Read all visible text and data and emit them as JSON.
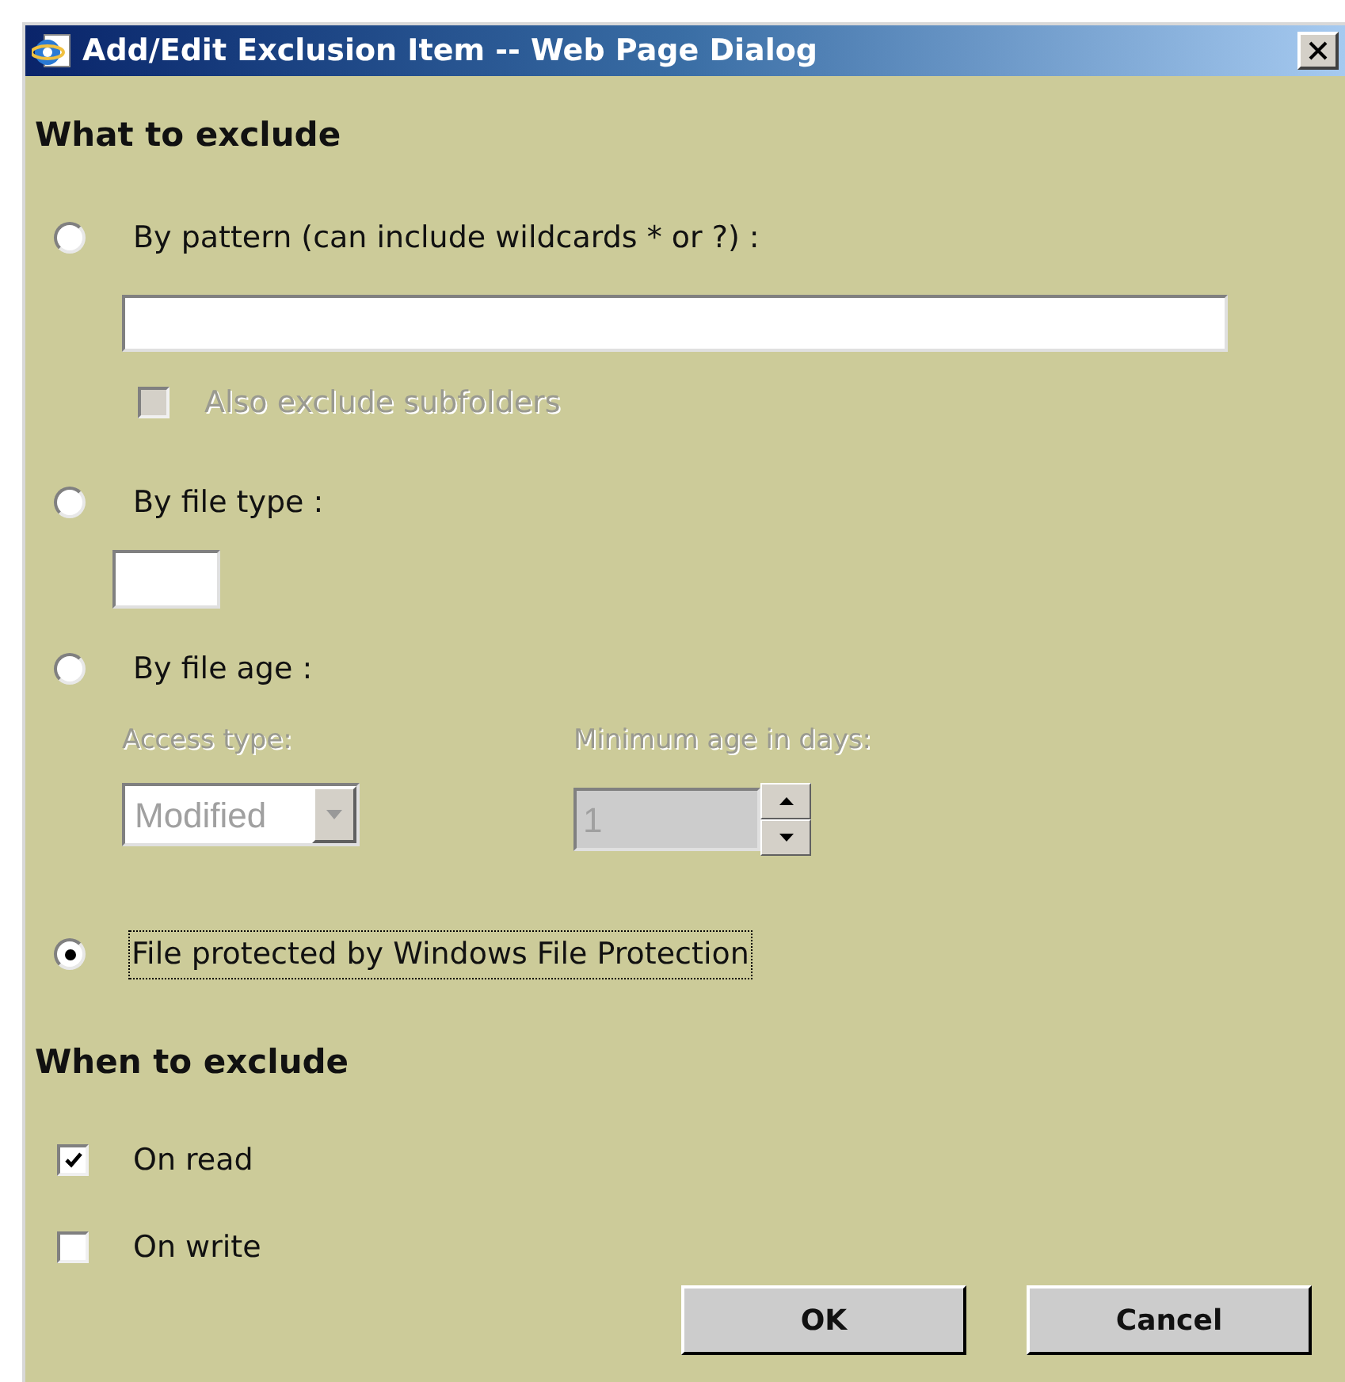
{
  "window": {
    "title": "Add/Edit Exclusion Item -- Web Page Dialog"
  },
  "what": {
    "heading": "What to exclude",
    "options": [
      {
        "kind": "pattern",
        "label": "By pattern (can include wildcards * or ?) :",
        "selected": false,
        "focused": false,
        "subfolders": {
          "label": "Also exclude subfolders",
          "checked": false,
          "disabled": true
        }
      },
      {
        "kind": "file_type",
        "label": "By file type :",
        "selected": false,
        "focused": false
      },
      {
        "kind": "file_age",
        "label": "By file age :",
        "selected": false,
        "focused": false,
        "access_label": "Access type:",
        "access_value": "Modified",
        "age_label": "Minimum age in days:",
        "age_value": "1",
        "disabled": true
      },
      {
        "kind": "wfp",
        "label": "File protected by Windows File Protection",
        "selected": true,
        "focused": true
      }
    ]
  },
  "when": {
    "heading": "When to exclude",
    "checks": [
      {
        "label": "On read",
        "checked": true
      },
      {
        "label": "On write",
        "checked": false
      }
    ]
  },
  "buttons": [
    {
      "label": "OK"
    },
    {
      "label": "Cancel"
    }
  ]
}
